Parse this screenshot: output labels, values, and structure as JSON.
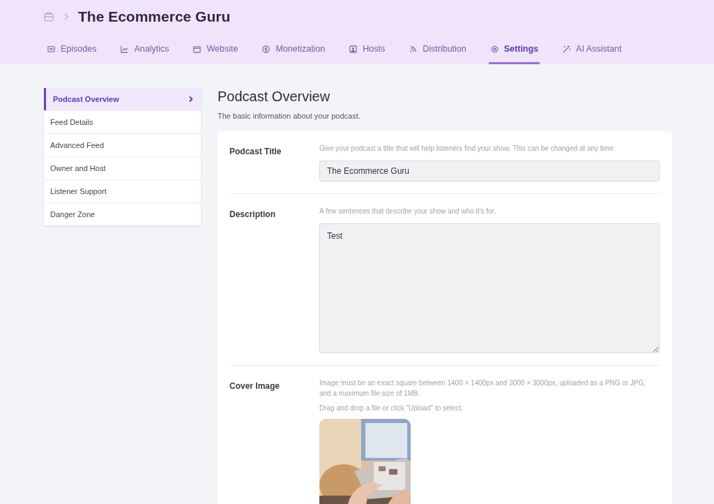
{
  "breadcrumb": {
    "title": "The Ecommerce Guru"
  },
  "tabs": [
    {
      "label": "Episodes",
      "kind": "list",
      "selected": false
    },
    {
      "label": "Analytics",
      "kind": "chart",
      "selected": false
    },
    {
      "label": "Website",
      "kind": "window",
      "selected": false
    },
    {
      "label": "Monetization",
      "kind": "dollar",
      "selected": false
    },
    {
      "label": "Hosts",
      "kind": "person",
      "selected": false
    },
    {
      "label": "Distribution",
      "kind": "rss",
      "selected": false
    },
    {
      "label": "Settings",
      "kind": "gear",
      "selected": true
    },
    {
      "label": "AI Assistant",
      "kind": "wand",
      "selected": false
    }
  ],
  "sidebar": {
    "items": [
      {
        "label": "Podcast Overview",
        "selected": true
      },
      {
        "label": "Feed Details",
        "selected": false
      },
      {
        "label": "Advanced Feed",
        "selected": false
      },
      {
        "label": "Owner and Host",
        "selected": false
      },
      {
        "label": "Listener Support",
        "selected": false
      },
      {
        "label": "Danger Zone",
        "selected": false
      }
    ]
  },
  "page": {
    "title": "Podcast Overview",
    "subtitle": "The basic information about your podcast."
  },
  "fields": [
    {
      "kind": "text",
      "label": "Podcast Title",
      "hints": [
        "Give your podcast a title that will help listeners find your show. This can be changed at any time."
      ],
      "value": "The Ecommerce Guru"
    },
    {
      "kind": "textarea",
      "label": "Description",
      "hints": [
        "A few sentences that describe your show and who it's for."
      ],
      "value": "Test"
    },
    {
      "label": "Cover Image",
      "hints": [
        "Image must be an exact square between 1400 × 1400px and 3000 × 3000px, uploaded as a PNG or JPG, and a maximum file size of 1MB.",
        "Drag and drop a file or click \"Upload\" to select."
      ]
    }
  ]
}
